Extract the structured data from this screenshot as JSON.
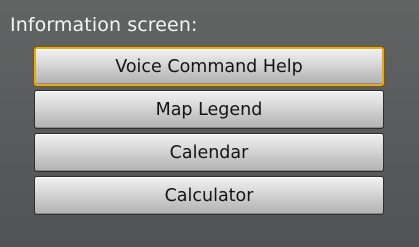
{
  "screen": {
    "title": "Information screen:"
  },
  "menu": {
    "items": [
      {
        "label": "Voice Command Help",
        "selected": true
      },
      {
        "label": "Map Legend",
        "selected": false
      },
      {
        "label": "Calendar",
        "selected": false
      },
      {
        "label": "Calculator",
        "selected": false
      }
    ]
  },
  "colors": {
    "background": "#5a5c5d",
    "title_text": "#f4f4f4",
    "selection_border": "#e3aa1e",
    "button_text": "#141414"
  }
}
